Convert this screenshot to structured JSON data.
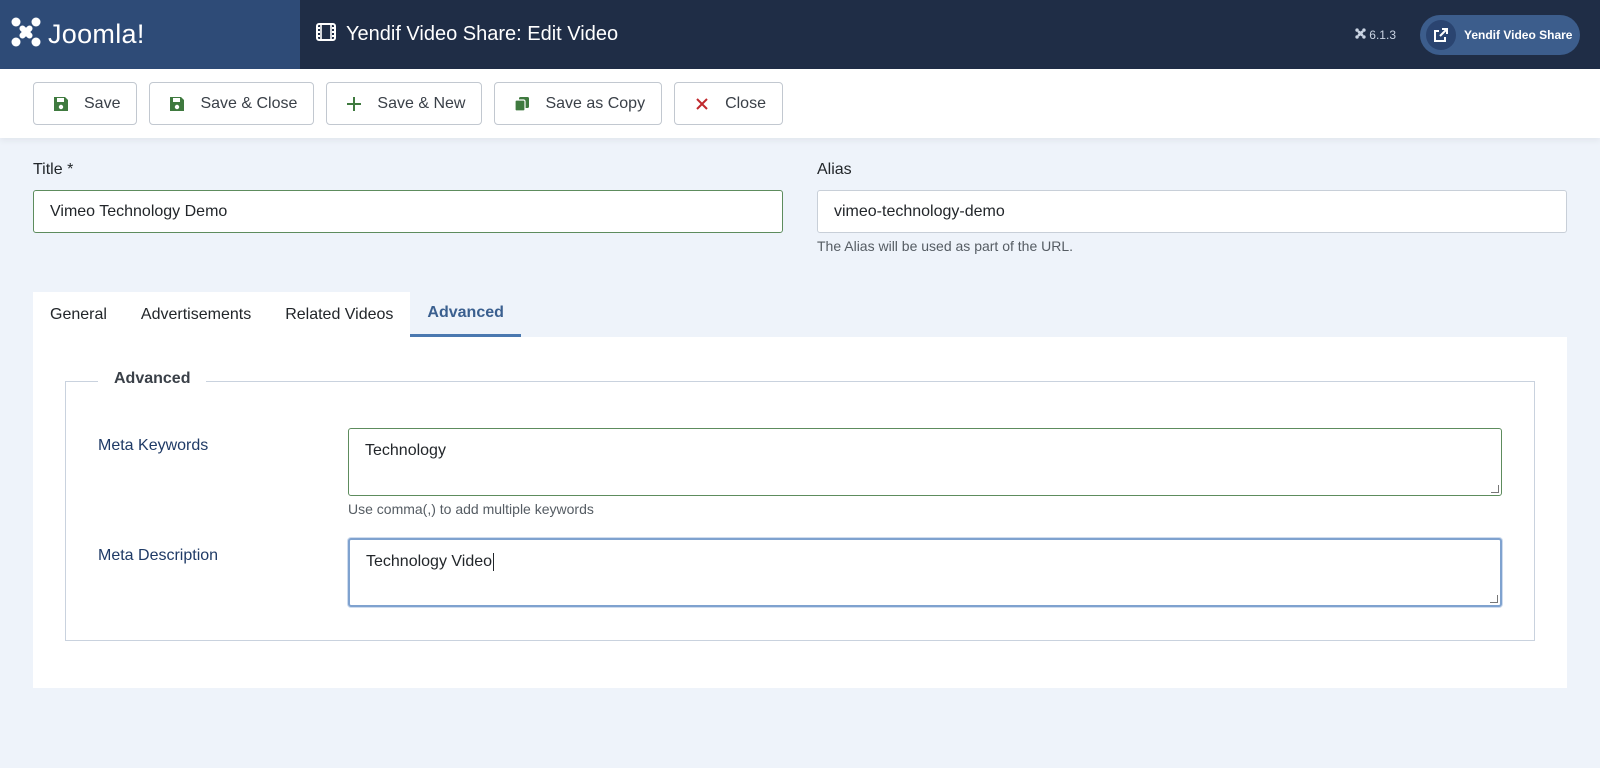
{
  "header": {
    "logo_text": "Joomla!",
    "logo_icon": "joomla-logo-icon",
    "page_title": "Yendif Video Share: Edit Video",
    "title_icon": "film-icon",
    "version": "6.1.3",
    "version_icon": "joomla-small-icon",
    "external_button": "Yendif Video Share",
    "external_icon": "external-link-icon"
  },
  "toolbar": {
    "save": "Save",
    "save_close": "Save & Close",
    "save_new": "Save & New",
    "save_copy": "Save as Copy",
    "close": "Close"
  },
  "form": {
    "title_label": "Title *",
    "title_value": "Vimeo Technology Demo",
    "alias_label": "Alias",
    "alias_value": "vimeo-technology-demo",
    "alias_hint": "The Alias will be used as part of the URL."
  },
  "tabs": [
    {
      "label": "General"
    },
    {
      "label": "Advertisements"
    },
    {
      "label": "Related Videos"
    },
    {
      "label": "Advanced"
    }
  ],
  "active_tab": "Advanced",
  "advanced": {
    "legend": "Advanced",
    "meta_keywords_label": "Meta Keywords",
    "meta_keywords_value": "Technology",
    "meta_keywords_hint": "Use comma(,) to add multiple keywords",
    "meta_description_label": "Meta Description",
    "meta_description_value": "Technology Video"
  },
  "colors": {
    "header_bg": "#1f2d46",
    "logo_bg": "#2e4b77",
    "page_bg": "#eef3fa",
    "accent": "#3a5f8f",
    "save_icon": "#3f7a3f",
    "close_icon": "#c0282d"
  }
}
